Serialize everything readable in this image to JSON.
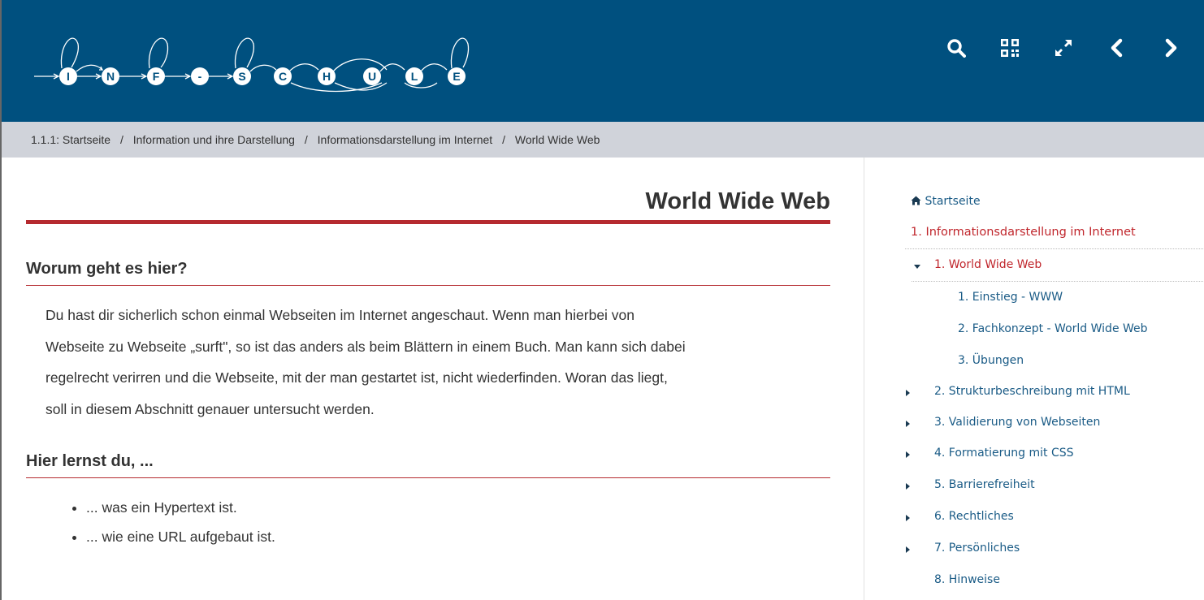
{
  "logo": {
    "letters": [
      "I",
      "N",
      "F",
      "-",
      "S",
      "C",
      "H",
      "U",
      "L",
      "E"
    ]
  },
  "toolbar": {
    "icons": [
      "search-icon",
      "qr-code-icon",
      "expand-icon",
      "chevron-left-icon",
      "chevron-right-icon"
    ]
  },
  "breadcrumb": {
    "prefix": "1.1.1:",
    "items": [
      "Startseite",
      "Information und ihre Darstellung",
      "Informationsdarstellung im Internet",
      "World Wide Web"
    ],
    "separator": "/"
  },
  "main": {
    "title": "World Wide Web",
    "section1": {
      "heading": "Worum geht es hier?",
      "lines": [
        "Du hast dir sicherlich schon einmal Webseiten im Internet angeschaut. Wenn man hierbei von",
        "Webseite zu Webseite „surft\", so ist das anders als beim Blättern in einem Buch. Man kann sich dabei",
        "regelrecht verirren und die Webseite, mit der man gestartet ist, nicht wiederfinden. Woran das liegt,",
        "soll in diesem Abschnitt genauer untersucht werden."
      ]
    },
    "section2": {
      "heading": "Hier lernst du, ...",
      "items": [
        "... was ein Hypertext ist.",
        "... wie eine URL aufgebaut ist."
      ]
    }
  },
  "sidebar": {
    "home": "Startseite",
    "chapter": "1. Informationsdarstellung im Internet",
    "current": "1. World Wide Web",
    "subitems": [
      "1. Einstieg - WWW",
      "2. Fachkonzept - World Wide Web",
      "3. Übungen"
    ],
    "items": [
      "2. Strukturbeschreibung mit HTML",
      "3. Validierung von Webseiten",
      "4. Formatierung mit CSS",
      "5. Barrierefreiheit",
      "6. Rechtliches",
      "7. Persönliches",
      "8. Hinweise"
    ]
  },
  "colors": {
    "header_bg": "#00507f",
    "breadcrumb_bg": "#d0d3da",
    "accent_red": "#b52a2f",
    "nav_blue": "#1a5b86"
  }
}
